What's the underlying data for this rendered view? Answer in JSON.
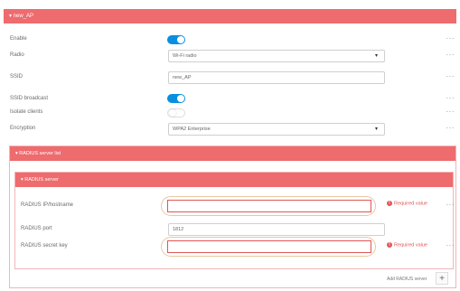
{
  "section": {
    "title": "▾ new_AP"
  },
  "fields": {
    "enable": {
      "label": "Enable"
    },
    "radio": {
      "label": "Radio",
      "value": "Wi-Fi radio"
    },
    "ssid": {
      "label": "SSID",
      "value": "new_AP"
    },
    "ssid_broadcast": {
      "label": "SSID broadcast"
    },
    "isolate_clients": {
      "label": "Isolate clients"
    },
    "encryption": {
      "label": "Encryption",
      "value": "WPA2 Enterprise"
    }
  },
  "radius_list": {
    "title": "▾ RADIUS server list"
  },
  "radius_server": {
    "title": "▾ RADIUS server",
    "hostname_label": "RADIUS IP/hostname",
    "port_label": "RADIUS port",
    "port_value": "1812",
    "secret_label": "RADIUS secret key",
    "required_text": "Required value"
  },
  "more_glyph": "···",
  "chevron": "▾",
  "add_label": "Add RADIUS server",
  "plus": "+",
  "colors": {
    "accent": "#ee6b6e",
    "toggle_on": "#0a8ee0",
    "error": "#e05555"
  }
}
